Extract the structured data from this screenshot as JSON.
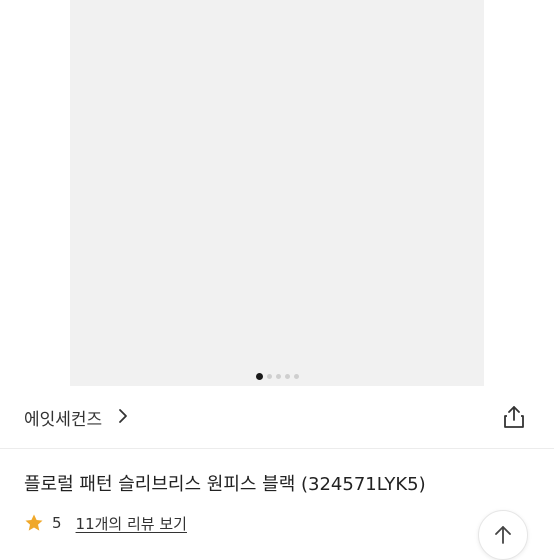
{
  "gallery": {
    "image_alt": "",
    "page_count": 5,
    "active_page": 1
  },
  "brand": {
    "name": "에잇세컨즈"
  },
  "product": {
    "title": "플로럴 패턴 슬리브리스 원피스 블랙 (324571LYK5)"
  },
  "rating": {
    "value": "5",
    "review_link": "11개의 리뷰 보기"
  },
  "icons": {
    "brand_chevron": "chevron-right-icon",
    "share": "share-icon",
    "star": "star-icon",
    "scroll_top": "arrow-up-icon"
  },
  "colors": {
    "star": "#f0a82a",
    "dress": "#1b1516",
    "flower_pink": "#e0618a",
    "flower_green": "#5e8a5a"
  }
}
